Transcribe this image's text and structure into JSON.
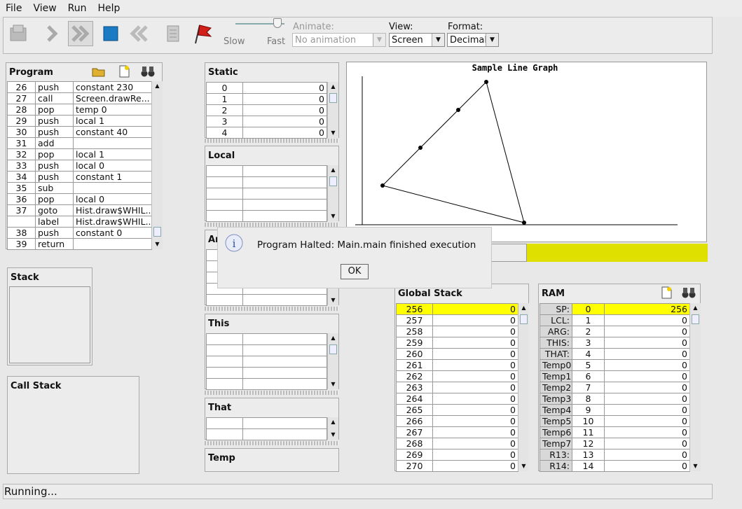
{
  "menu": [
    "File",
    "View",
    "Run",
    "Help"
  ],
  "toolbar": {
    "slow": "Slow",
    "fast": "Fast",
    "animate_label": "Animate:",
    "animate_value": "No animation",
    "view_label": "View:",
    "view_value": "Screen",
    "format_label": "Format:",
    "format_value": "Decimal"
  },
  "program": {
    "title": "Program",
    "rows": [
      [
        "26",
        "push",
        "constant 230"
      ],
      [
        "27",
        "call",
        "Screen.drawRe..."
      ],
      [
        "28",
        "pop",
        "temp 0"
      ],
      [
        "29",
        "push",
        "local 1"
      ],
      [
        "30",
        "push",
        "constant 40"
      ],
      [
        "31",
        "add",
        ""
      ],
      [
        "32",
        "pop",
        "local 1"
      ],
      [
        "33",
        "push",
        "local 0"
      ],
      [
        "34",
        "push",
        "constant 1"
      ],
      [
        "35",
        "sub",
        ""
      ],
      [
        "36",
        "pop",
        "local 0"
      ],
      [
        "37",
        "goto",
        "Hist.draw$WHIL..."
      ],
      [
        "",
        "label",
        "Hist.draw$WHIL..."
      ],
      [
        "38",
        "push",
        "constant 0"
      ],
      [
        "39",
        "return",
        ""
      ]
    ]
  },
  "stack": {
    "title": "Stack"
  },
  "call_stack": {
    "title": "Call Stack"
  },
  "static": {
    "title": "Static",
    "rows": [
      [
        "0",
        "0"
      ],
      [
        "1",
        "0"
      ],
      [
        "2",
        "0"
      ],
      [
        "3",
        "0"
      ],
      [
        "4",
        "0"
      ]
    ]
  },
  "local": {
    "title": "Local"
  },
  "argument": {
    "title": "Ar"
  },
  "this": {
    "title": "This"
  },
  "that": {
    "title": "That"
  },
  "temp": {
    "title": "Temp"
  },
  "screen": {
    "graph_title": "Sample Line Graph",
    "colors": {
      "bar": "#e0e000"
    }
  },
  "dialog": {
    "message": "Program Halted: Main.main finished execution",
    "ok": "OK",
    "icon": "info-icon"
  },
  "global_stack": {
    "title": "Global Stack",
    "rows": [
      [
        "256",
        "0"
      ],
      [
        "257",
        "0"
      ],
      [
        "258",
        "0"
      ],
      [
        "259",
        "0"
      ],
      [
        "260",
        "0"
      ],
      [
        "261",
        "0"
      ],
      [
        "262",
        "0"
      ],
      [
        "263",
        "0"
      ],
      [
        "264",
        "0"
      ],
      [
        "265",
        "0"
      ],
      [
        "266",
        "0"
      ],
      [
        "267",
        "0"
      ],
      [
        "268",
        "0"
      ],
      [
        "269",
        "0"
      ],
      [
        "270",
        "0"
      ]
    ]
  },
  "ram": {
    "title": "RAM",
    "rows": [
      [
        "SP:",
        "0",
        "256"
      ],
      [
        "LCL:",
        "1",
        "0"
      ],
      [
        "ARG:",
        "2",
        "0"
      ],
      [
        "THIS:",
        "3",
        "0"
      ],
      [
        "THAT:",
        "4",
        "0"
      ],
      [
        "Temp0:",
        "5",
        "0"
      ],
      [
        "Temp1:",
        "6",
        "0"
      ],
      [
        "Temp2:",
        "7",
        "0"
      ],
      [
        "Temp3:",
        "8",
        "0"
      ],
      [
        "Temp4:",
        "9",
        "0"
      ],
      [
        "Temp5:",
        "10",
        "0"
      ],
      [
        "Temp6:",
        "11",
        "0"
      ],
      [
        "Temp7:",
        "12",
        "0"
      ],
      [
        "R13:",
        "13",
        "0"
      ],
      [
        "R14:",
        "14",
        "0"
      ]
    ]
  },
  "status": "Running..."
}
